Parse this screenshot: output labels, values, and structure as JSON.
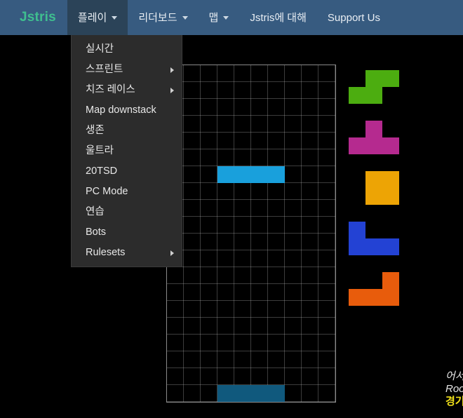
{
  "navbar": {
    "brand": "Jstris",
    "items": [
      {
        "label": "플레이",
        "caret": true,
        "active": true,
        "name": "nav-play"
      },
      {
        "label": "리더보드",
        "caret": true,
        "active": false,
        "name": "nav-leaderboard"
      },
      {
        "label": "맵",
        "caret": true,
        "active": false,
        "name": "nav-maps"
      },
      {
        "label": "Jstris에 대해",
        "caret": false,
        "active": false,
        "name": "nav-about"
      },
      {
        "label": "Support Us",
        "caret": false,
        "active": false,
        "name": "nav-support"
      }
    ]
  },
  "dropdown": {
    "open": true,
    "items": [
      {
        "label": "실시간",
        "submenu": false
      },
      {
        "label": "스프린트",
        "submenu": true
      },
      {
        "label": "치즈 레이스",
        "submenu": true
      },
      {
        "label": "Map downstack",
        "submenu": false
      },
      {
        "label": "생존",
        "submenu": false
      },
      {
        "label": "울트라",
        "submenu": false
      },
      {
        "label": "20TSD",
        "submenu": false
      },
      {
        "label": "PC Mode",
        "submenu": false
      },
      {
        "label": "연습",
        "submenu": false
      },
      {
        "label": "Bots",
        "submenu": false
      },
      {
        "label": "Rulesets",
        "submenu": true
      }
    ]
  },
  "board": {
    "columns": 10,
    "rows": 20,
    "cell_size": 24,
    "grid_visible": true,
    "border_color": "#8a8a8a",
    "background": "#000000",
    "active_piece": {
      "type": "I",
      "color": "#19a0dc",
      "cells": [
        [
          3,
          6
        ],
        [
          4,
          6
        ],
        [
          5,
          6
        ],
        [
          6,
          6
        ]
      ]
    },
    "ghost_piece": {
      "type": "I",
      "color": "#10597d",
      "cells": [
        [
          3,
          19
        ],
        [
          4,
          19
        ],
        [
          5,
          19
        ],
        [
          6,
          19
        ]
      ]
    }
  },
  "queue": {
    "pieces": [
      {
        "type": "S",
        "color": "#4cad10",
        "cells": [
          [
            1,
            0
          ],
          [
            2,
            0
          ],
          [
            0,
            1
          ],
          [
            1,
            1
          ]
        ]
      },
      {
        "type": "T",
        "color": "#b52a8f",
        "cells": [
          [
            1,
            0
          ],
          [
            0,
            1
          ],
          [
            1,
            1
          ],
          [
            2,
            1
          ]
        ]
      },
      {
        "type": "O",
        "color": "#eda405",
        "cells": [
          [
            1,
            0
          ],
          [
            2,
            0
          ],
          [
            1,
            1
          ],
          [
            2,
            1
          ]
        ]
      },
      {
        "type": "J",
        "color": "#2342d4",
        "cells": [
          [
            0,
            0
          ],
          [
            0,
            1
          ],
          [
            1,
            1
          ],
          [
            2,
            1
          ]
        ]
      },
      {
        "type": "L",
        "color": "#e85c0c",
        "cells": [
          [
            2,
            0
          ],
          [
            0,
            1
          ],
          [
            1,
            1
          ],
          [
            2,
            1
          ]
        ]
      }
    ]
  },
  "sidepanel": {
    "lines": [
      {
        "text": "어서",
        "color": "#e6e6e6"
      },
      {
        "text": "Roo",
        "color": "#e6e6e6"
      },
      {
        "text": "경기",
        "color": "#f2e21a"
      }
    ]
  },
  "colors": {
    "navbar_bg": "#375b80",
    "navbar_active_bg": "#2b4358",
    "brand": "#3fbf8f",
    "dropdown_bg": "#2c2c2c",
    "page_bg": "#000000"
  }
}
